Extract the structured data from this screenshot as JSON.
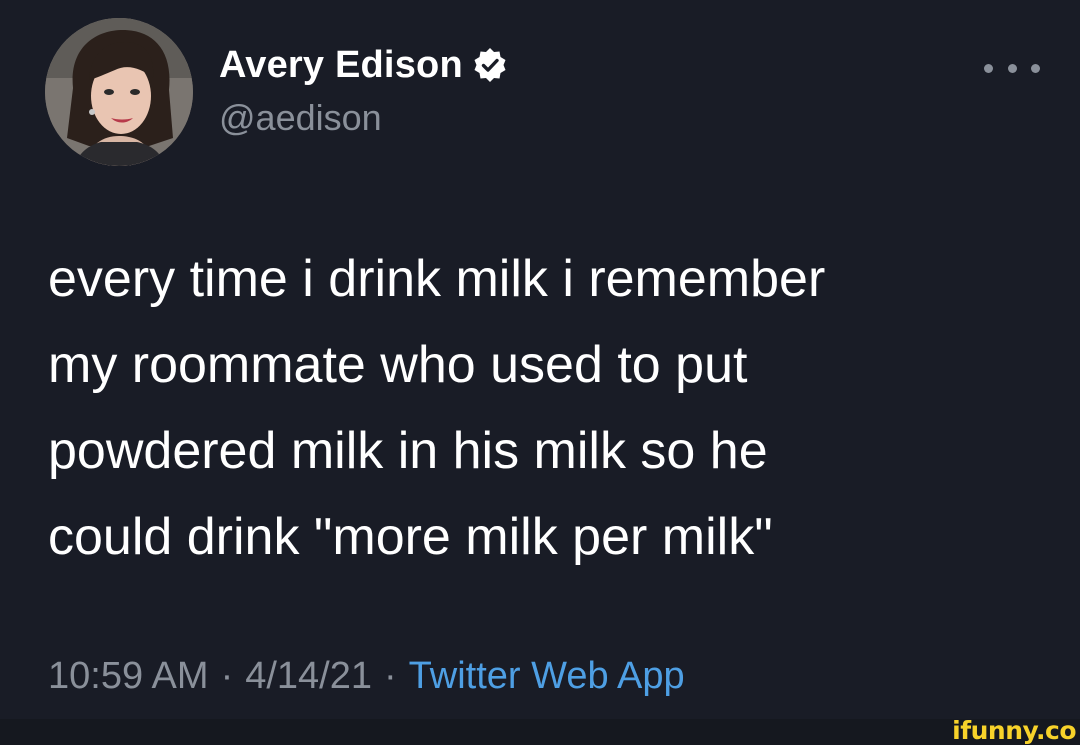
{
  "author": {
    "display_name": "Avery Edison",
    "handle": "@aedison",
    "verified": true,
    "avatar_icon": "profile-photo"
  },
  "tweet": {
    "text": "every time i drink milk i remember\nmy roommate who used to put\npowdered milk in his milk so he\ncould drink \"more milk per milk\""
  },
  "meta": {
    "time": "10:59 AM",
    "date": "4/14/21",
    "separator": "·",
    "source": "Twitter Web App"
  },
  "watermark": {
    "text": "ifunny.co"
  },
  "colors": {
    "background": "#191c26",
    "text": "#ffffff",
    "muted": "#8a909a",
    "link": "#4e9fe4",
    "watermark": "#f7d22a"
  }
}
